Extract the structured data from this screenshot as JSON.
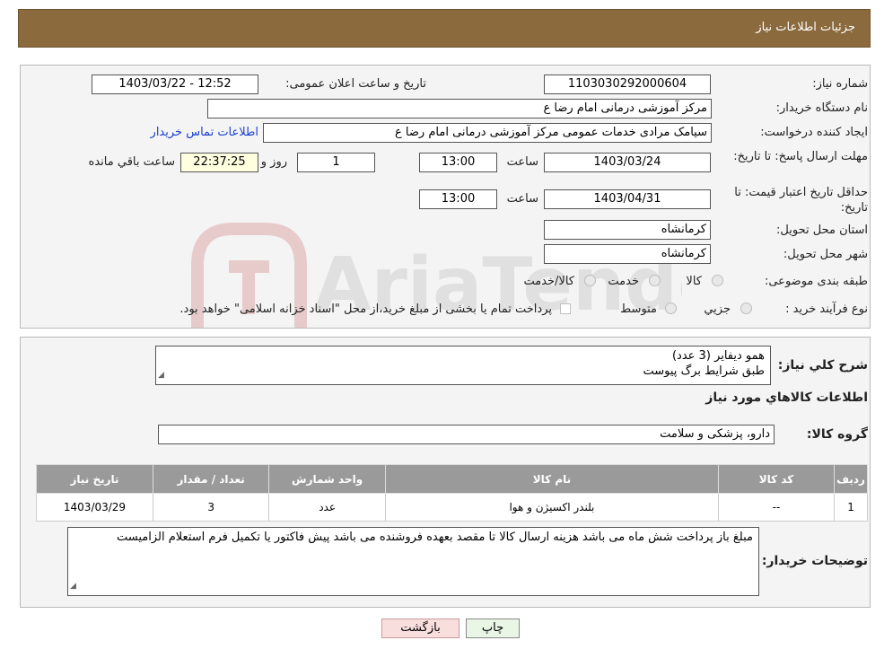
{
  "header": {
    "title": "جزئیات اطلاعات نیاز"
  },
  "form": {
    "need_number": {
      "label": "شماره نیاز:",
      "value": "1103030292000604"
    },
    "announce_datetime": {
      "label": "تاریخ و ساعت اعلان عمومی:",
      "value": "1403/03/22 - 12:52"
    },
    "buyer_org": {
      "label": "نام دستگاه خریدار:",
      "value": "مرکز آموزشی  درمانی امام رضا  ع"
    },
    "requester": {
      "label": "ایجاد کننده درخواست:",
      "value": "سیامک مرادی خدمات عمومی مرکز آموزشی  درمانی امام رضا  ع"
    },
    "buyer_contact_link": "اطلاعات تماس خریدار",
    "reply_deadline": {
      "label": "مهلت ارسال پاسخ: تا تاریخ:",
      "date": "1403/03/24",
      "time_label": "ساعت",
      "time": "13:00",
      "days": "1",
      "days_label": "روز و",
      "remaining": "22:37:25",
      "remaining_label": "ساعت باقي مانده"
    },
    "price_validity": {
      "label": "حداقل تاریخ اعتبار قیمت: تا تاریخ:",
      "date": "1403/04/31",
      "time_label": "ساعت",
      "time": "13:00"
    },
    "province": {
      "label": "استان محل تحویل:",
      "value": "کرمانشاه"
    },
    "city": {
      "label": "شهر محل تحویل:",
      "value": "کرمانشاه"
    },
    "category": {
      "label": "طبقه بندی موضوعی:",
      "options": [
        "کالا",
        "خدمت",
        "کالا/خدمت"
      ]
    },
    "purchase_type": {
      "label": "نوع فرآیند خرید :",
      "options": [
        "جزیي",
        "متوسط"
      ],
      "note": "پرداخت تمام یا بخشی از مبلغ خرید،از محل \"اسناد خزانه اسلامی\" خواهد بود."
    }
  },
  "details": {
    "general_desc_label": "شرح کلي نياز:",
    "general_desc_lines": [
      "همو دیفایر (3 عدد)",
      "طبق شرایط برگ پیوست"
    ],
    "goods_info_title": "اطلاعات کالاهاي مورد نياز",
    "goods_group_label": "گروه کالا:",
    "goods_group_value": "دارو، پزشکی و سلامت",
    "table": {
      "headers": [
        "رديف",
        "کد کالا",
        "نام کالا",
        "واحد شمارش",
        "تعداد / مقدار",
        "تاریخ نیاز"
      ],
      "rows": [
        [
          "1",
          "--",
          "بلندر اکسیژن و هوا",
          "عدد",
          "3",
          "1403/03/29"
        ]
      ]
    },
    "buyer_notes_label": "توضیحات خریدار:",
    "buyer_notes": "مبلغ باز پرداخت شش ماه می باشد هزینه ارسال کالا تا مقصد بعهده فروشنده می باشد پیش فاکتور یا تکمیل فرم استعلام الزامیست"
  },
  "buttons": {
    "print": "چاپ",
    "back": "بازگشت"
  },
  "watermark": "AriaTender.neT",
  "colors": {
    "header_bg": "#8b6a3e",
    "link": "#1a3fd0",
    "table_header": "#9a9a9a",
    "print_btn": "#e9f6e6",
    "back_btn": "#f9dede"
  }
}
